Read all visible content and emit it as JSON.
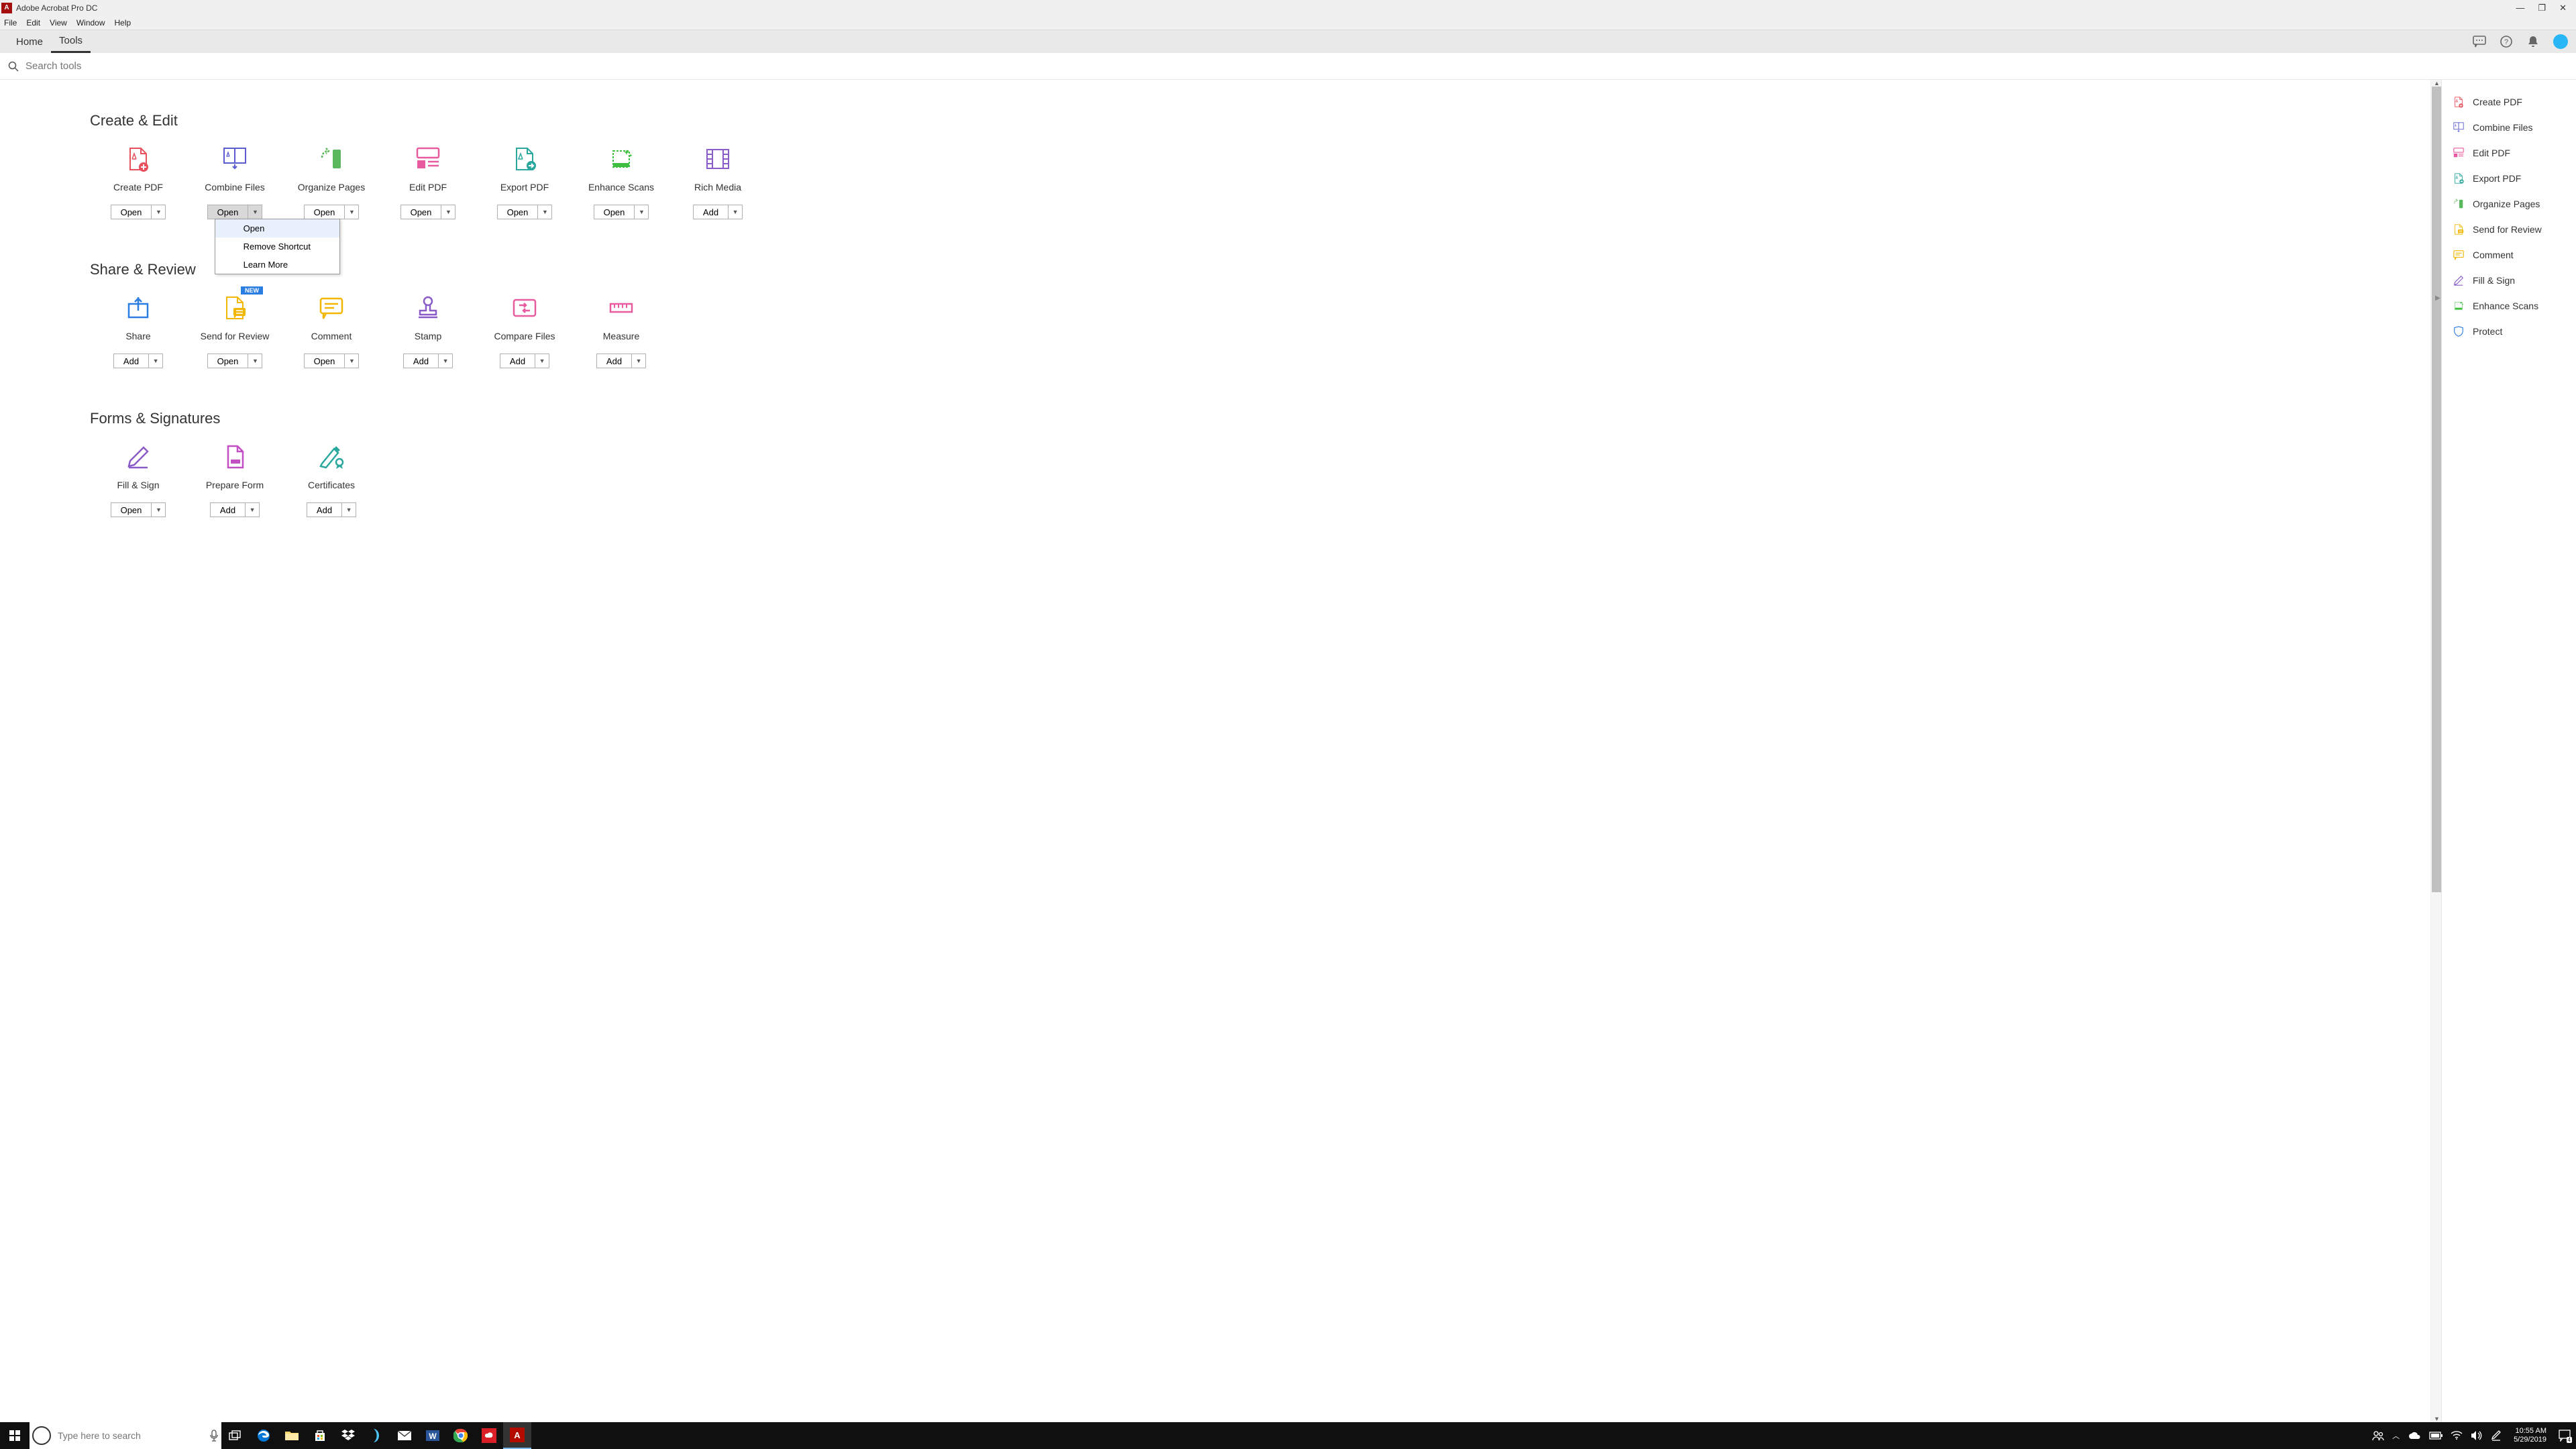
{
  "titlebar": {
    "app_name": "Adobe Acrobat Pro DC"
  },
  "menubar": [
    "File",
    "Edit",
    "View",
    "Window",
    "Help"
  ],
  "tabs": {
    "home": "Home",
    "tools": "Tools"
  },
  "search": {
    "placeholder": "Search tools"
  },
  "sections": [
    {
      "title": "Create & Edit",
      "tools": [
        {
          "label": "Create PDF",
          "button": "Open",
          "icon": "create-pdf"
        },
        {
          "label": "Combine Files",
          "button": "Open",
          "icon": "combine",
          "dropdown_open": true,
          "pressed": true
        },
        {
          "label": "Organize Pages",
          "button": "Open",
          "icon": "organize"
        },
        {
          "label": "Edit PDF",
          "button": "Open",
          "icon": "edit-pdf"
        },
        {
          "label": "Export PDF",
          "button": "Open",
          "icon": "export-pdf"
        },
        {
          "label": "Enhance Scans",
          "button": "Open",
          "icon": "enhance"
        },
        {
          "label": "Rich Media",
          "button": "Add",
          "icon": "rich-media"
        }
      ]
    },
    {
      "title": "Share & Review",
      "tools": [
        {
          "label": "Share",
          "button": "Add",
          "icon": "share"
        },
        {
          "label": "Send for Review",
          "button": "Open",
          "icon": "send-review",
          "badge": "NEW"
        },
        {
          "label": "Comment",
          "button": "Open",
          "icon": "comment"
        },
        {
          "label": "Stamp",
          "button": "Add",
          "icon": "stamp"
        },
        {
          "label": "Compare Files",
          "button": "Add",
          "icon": "compare"
        },
        {
          "label": "Measure",
          "button": "Add",
          "icon": "measure"
        }
      ]
    },
    {
      "title": "Forms & Signatures",
      "tools": [
        {
          "label": "Fill & Sign",
          "button": "Open",
          "icon": "fill-sign"
        },
        {
          "label": "Prepare Form",
          "button": "Add",
          "icon": "prepare-form"
        },
        {
          "label": "Certificates",
          "button": "Add",
          "icon": "certificates"
        }
      ]
    }
  ],
  "dropdown_items": [
    "Open",
    "Remove Shortcut",
    "Learn More"
  ],
  "right_panel": [
    {
      "label": "Create PDF",
      "icon": "create-pdf"
    },
    {
      "label": "Combine Files",
      "icon": "combine"
    },
    {
      "label": "Edit PDF",
      "icon": "edit-pdf"
    },
    {
      "label": "Export PDF",
      "icon": "export-pdf"
    },
    {
      "label": "Organize Pages",
      "icon": "organize"
    },
    {
      "label": "Send for Review",
      "icon": "send-review"
    },
    {
      "label": "Comment",
      "icon": "comment"
    },
    {
      "label": "Fill & Sign",
      "icon": "fill-sign"
    },
    {
      "label": "Enhance Scans",
      "icon": "enhance"
    },
    {
      "label": "Protect",
      "icon": "protect"
    }
  ],
  "taskbar": {
    "search_placeholder": "Type here to search",
    "time": "10:55 AM",
    "date": "5/29/2019",
    "notification_count": "4"
  },
  "colors": {
    "create_pdf": "#e8505b",
    "combine": "#5c5ccf",
    "organize": "#5cb85c",
    "edit_pdf": "#e85b9e",
    "export_pdf": "#2aa89e",
    "enhance": "#3fbf3f",
    "rich_media": "#8a5cc7",
    "share": "#2a7de1",
    "send_review": "#f2b705",
    "comment": "#f2b705",
    "stamp": "#8a5cc7",
    "compare": "#e85b9e",
    "measure": "#e85b9e",
    "fill_sign": "#8a5cc7",
    "prepare_form": "#c44fc4",
    "certificates": "#2aa89e",
    "protect": "#2a7de1"
  }
}
